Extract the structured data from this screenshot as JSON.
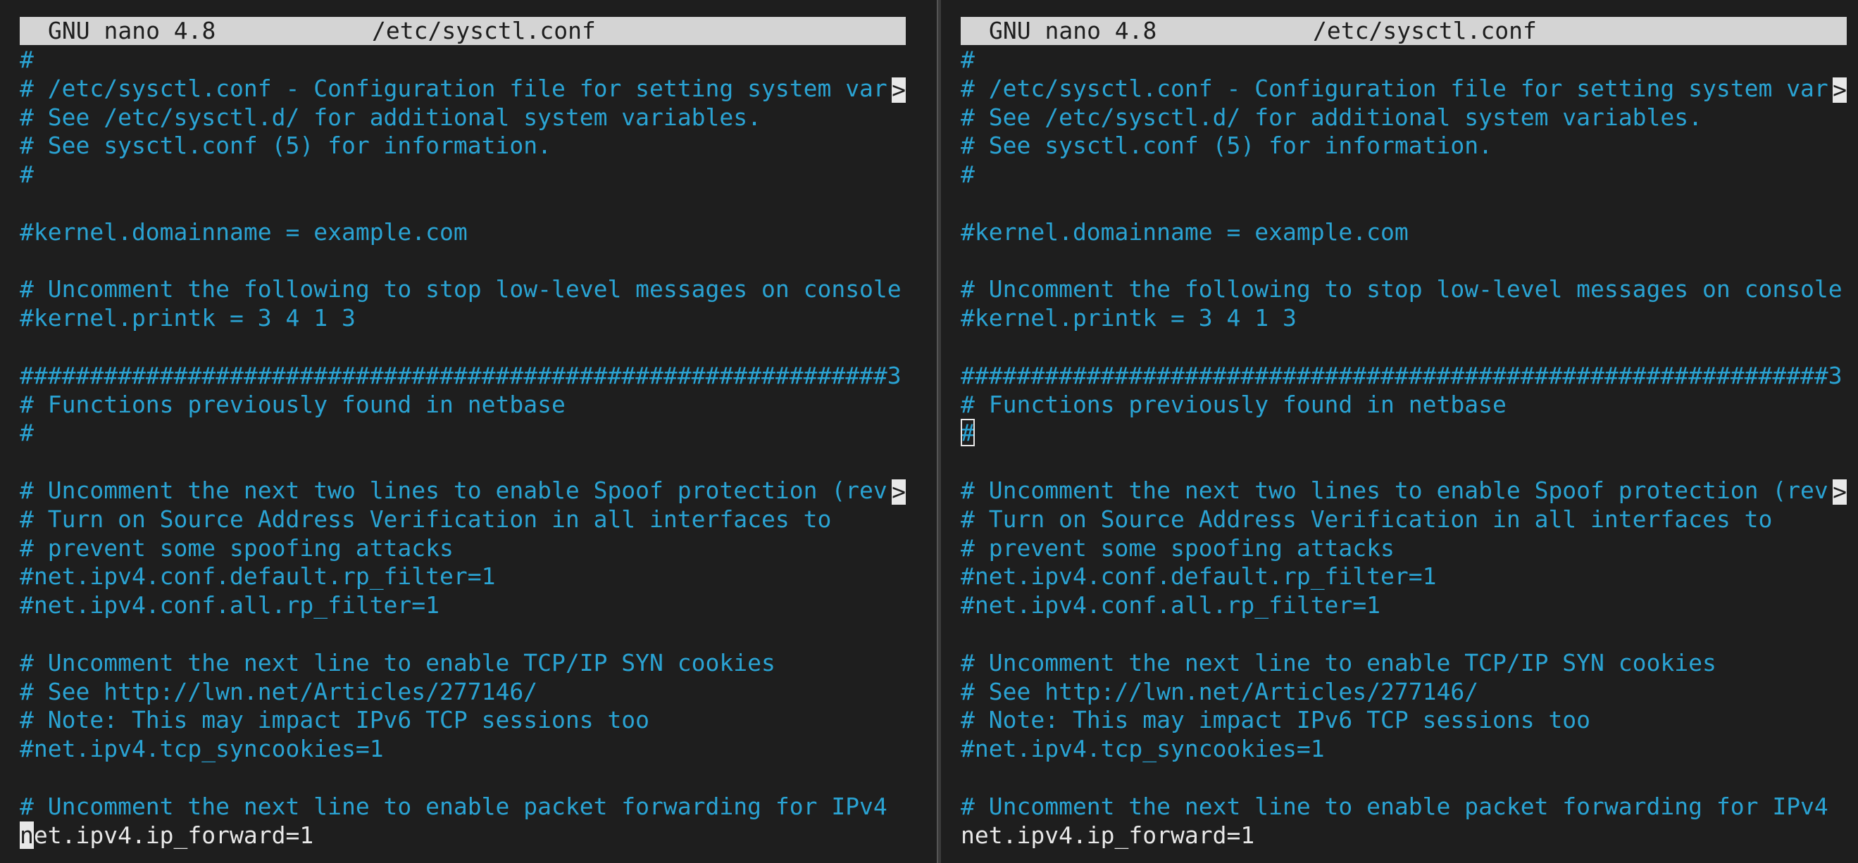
{
  "panes": [
    {
      "app_name": "GNU nano 4.8",
      "file_name": "/etc/sysctl.conf",
      "cursor_line": 28,
      "cursor_style": "block",
      "lines": [
        {
          "text": "#",
          "kind": "comment"
        },
        {
          "text": "# /etc/sysctl.conf - Configuration file for setting system var",
          "kind": "comment",
          "truncated": true
        },
        {
          "text": "# See /etc/sysctl.d/ for additional system variables.",
          "kind": "comment"
        },
        {
          "text": "# See sysctl.conf (5) for information.",
          "kind": "comment"
        },
        {
          "text": "#",
          "kind": "comment"
        },
        {
          "text": "",
          "kind": "blank"
        },
        {
          "text": "#kernel.domainname = example.com",
          "kind": "comment"
        },
        {
          "text": "",
          "kind": "blank"
        },
        {
          "text": "# Uncomment the following to stop low-level messages on console",
          "kind": "comment"
        },
        {
          "text": "#kernel.printk = 3 4 1 3",
          "kind": "comment"
        },
        {
          "text": "",
          "kind": "blank"
        },
        {
          "text": "##############################################################3",
          "kind": "comment"
        },
        {
          "text": "# Functions previously found in netbase",
          "kind": "comment"
        },
        {
          "text": "#",
          "kind": "comment"
        },
        {
          "text": "",
          "kind": "blank"
        },
        {
          "text": "# Uncomment the next two lines to enable Spoof protection (rev",
          "kind": "comment",
          "truncated": true
        },
        {
          "text": "# Turn on Source Address Verification in all interfaces to",
          "kind": "comment"
        },
        {
          "text": "# prevent some spoofing attacks",
          "kind": "comment"
        },
        {
          "text": "#net.ipv4.conf.default.rp_filter=1",
          "kind": "comment"
        },
        {
          "text": "#net.ipv4.conf.all.rp_filter=1",
          "kind": "comment"
        },
        {
          "text": "",
          "kind": "blank"
        },
        {
          "text": "# Uncomment the next line to enable TCP/IP SYN cookies",
          "kind": "comment"
        },
        {
          "text": "# See http://lwn.net/Articles/277146/",
          "kind": "comment"
        },
        {
          "text": "# Note: This may impact IPv6 TCP sessions too",
          "kind": "comment"
        },
        {
          "text": "#net.ipv4.tcp_syncookies=1",
          "kind": "comment"
        },
        {
          "text": "",
          "kind": "blank"
        },
        {
          "text": "# Uncomment the next line to enable packet forwarding for IPv4",
          "kind": "comment"
        },
        {
          "text": "net.ipv4.ip_forward=1",
          "kind": "code"
        }
      ]
    },
    {
      "app_name": "GNU nano 4.8",
      "file_name": "/etc/sysctl.conf",
      "cursor_line": 14,
      "cursor_style": "outline",
      "lines": [
        {
          "text": "#",
          "kind": "comment"
        },
        {
          "text": "# /etc/sysctl.conf - Configuration file for setting system var",
          "kind": "comment",
          "truncated": true
        },
        {
          "text": "# See /etc/sysctl.d/ for additional system variables.",
          "kind": "comment"
        },
        {
          "text": "# See sysctl.conf (5) for information.",
          "kind": "comment"
        },
        {
          "text": "#",
          "kind": "comment"
        },
        {
          "text": "",
          "kind": "blank"
        },
        {
          "text": "#kernel.domainname = example.com",
          "kind": "comment"
        },
        {
          "text": "",
          "kind": "blank"
        },
        {
          "text": "# Uncomment the following to stop low-level messages on console",
          "kind": "comment"
        },
        {
          "text": "#kernel.printk = 3 4 1 3",
          "kind": "comment"
        },
        {
          "text": "",
          "kind": "blank"
        },
        {
          "text": "##############################################################3",
          "kind": "comment"
        },
        {
          "text": "# Functions previously found in netbase",
          "kind": "comment"
        },
        {
          "text": "#",
          "kind": "comment"
        },
        {
          "text": "",
          "kind": "blank"
        },
        {
          "text": "# Uncomment the next two lines to enable Spoof protection (rev",
          "kind": "comment",
          "truncated": true
        },
        {
          "text": "# Turn on Source Address Verification in all interfaces to",
          "kind": "comment"
        },
        {
          "text": "# prevent some spoofing attacks",
          "kind": "comment"
        },
        {
          "text": "#net.ipv4.conf.default.rp_filter=1",
          "kind": "comment"
        },
        {
          "text": "#net.ipv4.conf.all.rp_filter=1",
          "kind": "comment"
        },
        {
          "text": "",
          "kind": "blank"
        },
        {
          "text": "# Uncomment the next line to enable TCP/IP SYN cookies",
          "kind": "comment"
        },
        {
          "text": "# See http://lwn.net/Articles/277146/",
          "kind": "comment"
        },
        {
          "text": "# Note: This may impact IPv6 TCP sessions too",
          "kind": "comment"
        },
        {
          "text": "#net.ipv4.tcp_syncookies=1",
          "kind": "comment"
        },
        {
          "text": "",
          "kind": "blank"
        },
        {
          "text": "# Uncomment the next line to enable packet forwarding for IPv4",
          "kind": "comment"
        },
        {
          "text": "net.ipv4.ip_forward=1",
          "kind": "code"
        }
      ]
    }
  ],
  "truncation_marker": ">",
  "colors": {
    "background": "#1e1e1e",
    "titlebar": "#d4d4d4",
    "comment": "#2aa3d3",
    "code": "#e8e8e8"
  }
}
